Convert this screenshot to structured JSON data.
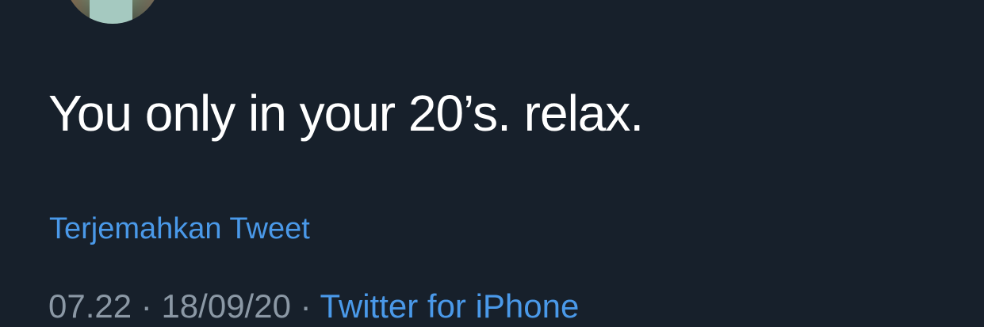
{
  "tweet": {
    "text": "You only in your 20’s. relax.",
    "translate_label": "Terjemahkan Tweet",
    "time": "07.22",
    "separator": "·",
    "date": "18/09/20",
    "source": "Twitter for iPhone"
  },
  "colors": {
    "background": "#17202b",
    "text": "#ffffff",
    "link": "#4a99e9",
    "muted": "#8b98a5"
  }
}
